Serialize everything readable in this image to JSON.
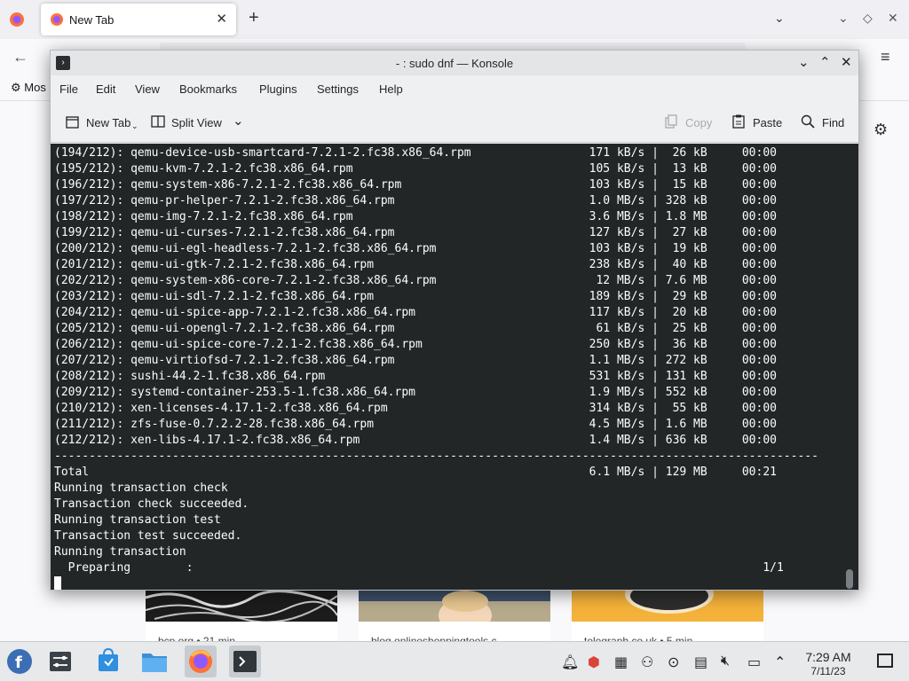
{
  "firefox": {
    "tab_title": "New Tab",
    "tab_close": "✕",
    "new_tab": "+",
    "list_tabs": "⌄",
    "minimize": "⌄",
    "restore": "◇",
    "close": "✕",
    "back": "←",
    "menu": "≡",
    "bookmark_label": "Mos",
    "settings_icon": "gear-icon",
    "cards": [
      {
        "caption": "bcp.org • 21 min"
      },
      {
        "caption": "blog.onlineshoppingtools.c"
      },
      {
        "caption": "telegraph.co.uk • 5 min"
      }
    ]
  },
  "konsole": {
    "title": "- : sudo dnf — Konsole",
    "menus": [
      "File",
      "Edit",
      "View",
      "Bookmarks",
      "Plugins",
      "Settings",
      "Help"
    ],
    "toolbar": {
      "new_tab": "New Tab",
      "split_view": "Split View",
      "copy": "Copy",
      "paste": "Paste",
      "find": "Find"
    },
    "terminal_lines": [
      "(194/212): qemu-device-usb-smartcard-7.2.1-2.fc38.x86_64.rpm                 171 kB/s |  26 kB     00:00",
      "(195/212): qemu-kvm-7.2.1-2.fc38.x86_64.rpm                                  105 kB/s |  13 kB     00:00",
      "(196/212): qemu-system-x86-7.2.1-2.fc38.x86_64.rpm                           103 kB/s |  15 kB     00:00",
      "(197/212): qemu-pr-helper-7.2.1-2.fc38.x86_64.rpm                            1.0 MB/s | 328 kB     00:00",
      "(198/212): qemu-img-7.2.1-2.fc38.x86_64.rpm                                  3.6 MB/s | 1.8 MB     00:00",
      "(199/212): qemu-ui-curses-7.2.1-2.fc38.x86_64.rpm                            127 kB/s |  27 kB     00:00",
      "(200/212): qemu-ui-egl-headless-7.2.1-2.fc38.x86_64.rpm                      103 kB/s |  19 kB     00:00",
      "(201/212): qemu-ui-gtk-7.2.1-2.fc38.x86_64.rpm                               238 kB/s |  40 kB     00:00",
      "(202/212): qemu-system-x86-core-7.2.1-2.fc38.x86_64.rpm                       12 MB/s | 7.6 MB     00:00",
      "(203/212): qemu-ui-sdl-7.2.1-2.fc38.x86_64.rpm                               189 kB/s |  29 kB     00:00",
      "(204/212): qemu-ui-spice-app-7.2.1-2.fc38.x86_64.rpm                         117 kB/s |  20 kB     00:00",
      "(205/212): qemu-ui-opengl-7.2.1-2.fc38.x86_64.rpm                             61 kB/s |  25 kB     00:00",
      "(206/212): qemu-ui-spice-core-7.2.1-2.fc38.x86_64.rpm                        250 kB/s |  36 kB     00:00",
      "(207/212): qemu-virtiofsd-7.2.1-2.fc38.x86_64.rpm                            1.1 MB/s | 272 kB     00:00",
      "(208/212): sushi-44.2-1.fc38.x86_64.rpm                                      531 kB/s | 131 kB     00:00",
      "(209/212): systemd-container-253.5-1.fc38.x86_64.rpm                         1.9 MB/s | 552 kB     00:00",
      "(210/212): xen-licenses-4.17.1-2.fc38.x86_64.rpm                             314 kB/s |  55 kB     00:00",
      "(211/212): zfs-fuse-0.7.2.2-28.fc38.x86_64.rpm                               4.5 MB/s | 1.6 MB     00:00",
      "(212/212): xen-libs-4.17.1-2.fc38.x86_64.rpm                                 1.4 MB/s | 636 kB     00:00",
      "--------------------------------------------------------------------------------------------------------------",
      "Total                                                                        6.1 MB/s | 129 MB     00:21",
      "Running transaction check",
      "Transaction check succeeded.",
      "Running transaction test",
      "Transaction test succeeded.",
      "Running transaction",
      "  Preparing        :                                                                                  1/1"
    ]
  },
  "taskbar": {
    "time": "7:29 AM",
    "date": "7/11/23"
  },
  "colors": {
    "terminal_bg": "#232627",
    "terminal_fg": "#fcfcfc",
    "fedora_blue": "#3c6eb4"
  }
}
